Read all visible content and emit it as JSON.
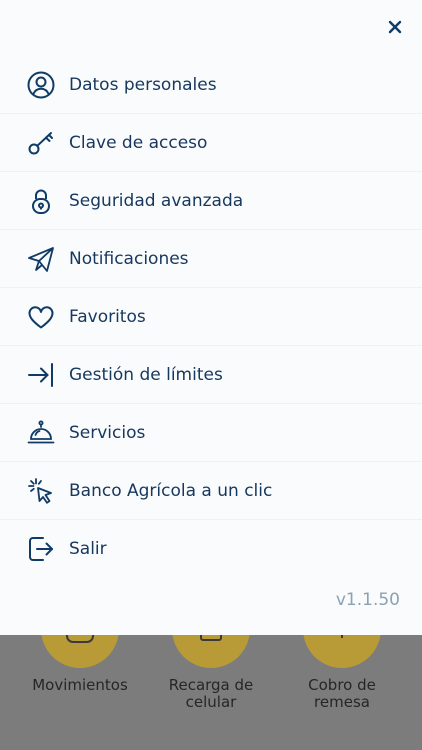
{
  "close": {
    "icon": "close-icon"
  },
  "menu": {
    "items": [
      {
        "label": "Datos personales",
        "icon": "user-circle-icon"
      },
      {
        "label": "Clave de acceso",
        "icon": "key-icon"
      },
      {
        "label": "Seguridad avanzada",
        "icon": "lock-icon"
      },
      {
        "label": "Notificaciones",
        "icon": "paper-plane-icon"
      },
      {
        "label": "Favoritos",
        "icon": "heart-icon"
      },
      {
        "label": "Gestión de límites",
        "icon": "arrow-to-bar-icon"
      },
      {
        "label": "Servicios",
        "icon": "service-bell-icon"
      },
      {
        "label": "Banco Agrícola a un clic",
        "icon": "click-pointer-icon"
      },
      {
        "label": "Salir",
        "icon": "logout-icon"
      }
    ]
  },
  "version": "v1.1.50",
  "background": {
    "tiles": [
      {
        "label": "Movimientos"
      },
      {
        "label": "Recarga de\ncelular"
      },
      {
        "label": "Cobro de\nremesa"
      }
    ]
  },
  "colors": {
    "primary": "#16375e",
    "icon": "#0f3b66",
    "muted": "#8ba1b4",
    "overlay": "#7c7c7c",
    "accent": "#b89a37"
  }
}
